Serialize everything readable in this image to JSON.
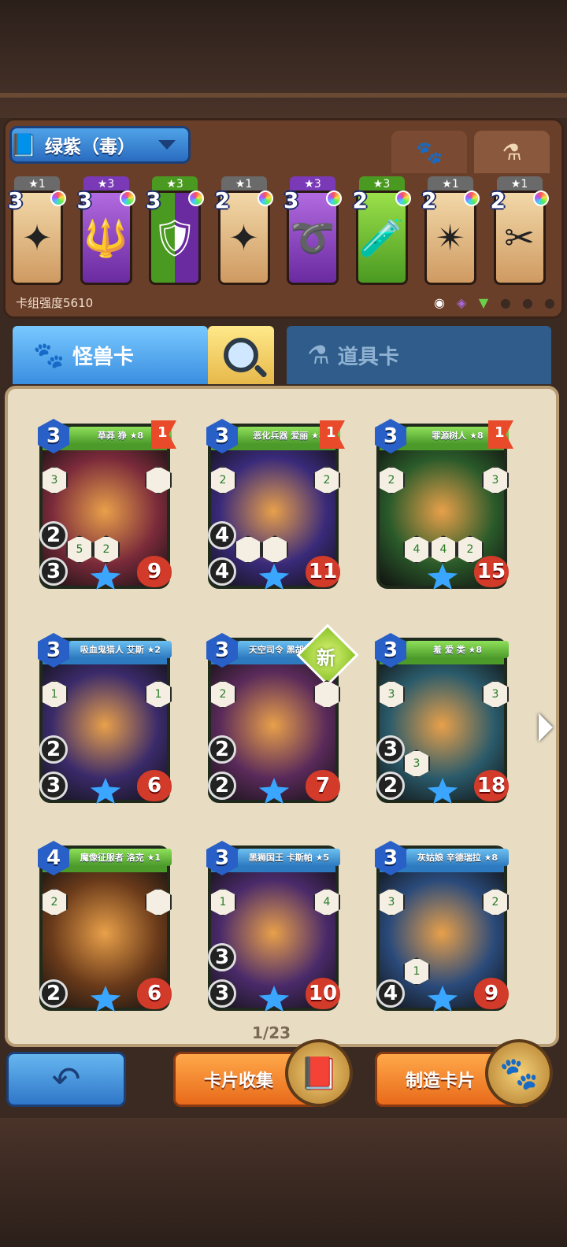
{
  "deck": {
    "name": "绿紫（毒）",
    "power_label": "卡组强度5610",
    "cards": [
      {
        "stars": "★1",
        "cost": "3",
        "color": "tan",
        "icon": "shuriken-icon",
        "glyph": "✦"
      },
      {
        "stars": "★3",
        "cost": "3",
        "color": "purple",
        "icon": "flame-spear-icon",
        "glyph": "🔱"
      },
      {
        "stars": "★3",
        "cost": "3",
        "color": "mixed",
        "icon": "armor-icon",
        "glyph": "🛡"
      },
      {
        "stars": "★1",
        "cost": "2",
        "color": "tan",
        "icon": "shuriken-icon",
        "glyph": "✦"
      },
      {
        "stars": "★3",
        "cost": "3",
        "color": "purple",
        "icon": "whip-icon",
        "glyph": "➰"
      },
      {
        "stars": "★3",
        "cost": "2",
        "color": "green",
        "icon": "slime-staff-icon",
        "glyph": "🧪"
      },
      {
        "stars": "★1",
        "cost": "2",
        "color": "tan",
        "icon": "throwing-star-icon",
        "glyph": "✴"
      },
      {
        "stars": "★1",
        "cost": "2",
        "color": "tan",
        "icon": "scissors-icon",
        "glyph": "✂"
      }
    ]
  },
  "tabs": {
    "monster": "怪兽卡",
    "item": "道具卡"
  },
  "cards": [
    {
      "name": "草莽 狰 ★8",
      "cost": "3",
      "flag": "1",
      "speed": "2",
      "attack": "3",
      "hp": "9",
      "banner": "green",
      "bg": "#7a2a3a",
      "skills": [
        "3",
        "",
        "5",
        "2"
      ],
      "new": ""
    },
    {
      "name": "恶化兵器 爱丽 ★8",
      "cost": "3",
      "flag": "1",
      "speed": "4",
      "attack": "4",
      "hp": "11",
      "banner": "green",
      "bg": "#3a2a7a",
      "skills": [
        "2",
        "2",
        "",
        ""
      ],
      "new": ""
    },
    {
      "name": "罪源树人 ★8",
      "cost": "3",
      "flag": "1",
      "speed": "",
      "attack": "",
      "hp": "15",
      "banner": "green",
      "bg": "#2a5a2a",
      "skills": [
        "2",
        "3",
        "4",
        "4",
        "2"
      ],
      "new": ""
    },
    {
      "name": "吸血鬼猎人 艾斯 ★2",
      "cost": "3",
      "flag": "",
      "speed": "2",
      "attack": "3",
      "hp": "6",
      "banner": "blue",
      "bg": "#3a2a6a",
      "skills": [
        "1",
        "1"
      ],
      "new": ""
    },
    {
      "name": "天空司令 黑胡子 ★1",
      "cost": "3",
      "flag": "",
      "speed": "2",
      "attack": "2",
      "hp": "7",
      "banner": "blue",
      "bg": "#5a2a5a",
      "skills": [
        "2",
        ""
      ],
      "new": "新"
    },
    {
      "name": "羞 爱 类 ★8",
      "cost": "3",
      "flag": "",
      "speed": "3",
      "attack": "2",
      "hp": "18",
      "banner": "green",
      "bg": "#2a5a6a",
      "skills": [
        "3",
        "3",
        "3"
      ],
      "new": ""
    },
    {
      "name": "魔像征服者 洛克 ★1",
      "cost": "4",
      "flag": "",
      "speed": "",
      "attack": "2",
      "hp": "6",
      "banner": "green",
      "bg": "#6a3a1a",
      "skills": [
        "2",
        ""
      ],
      "new": ""
    },
    {
      "name": "黑狮国王 卡斯帕 ★5",
      "cost": "3",
      "flag": "",
      "speed": "3",
      "attack": "3",
      "hp": "10",
      "banner": "blue",
      "bg": "#4a2a6a",
      "skills": [
        "1",
        "4"
      ],
      "new": ""
    },
    {
      "name": "灰姑娘 辛德瑞拉 ★8",
      "cost": "3",
      "flag": "",
      "speed": "",
      "attack": "4",
      "hp": "9",
      "banner": "blue",
      "bg": "#2a4a7a",
      "skills": [
        "3",
        "2",
        "1"
      ],
      "new": ""
    }
  ],
  "pager": "1/23",
  "buttons": {
    "collect": "卡片收集",
    "craft": "制造卡片"
  }
}
